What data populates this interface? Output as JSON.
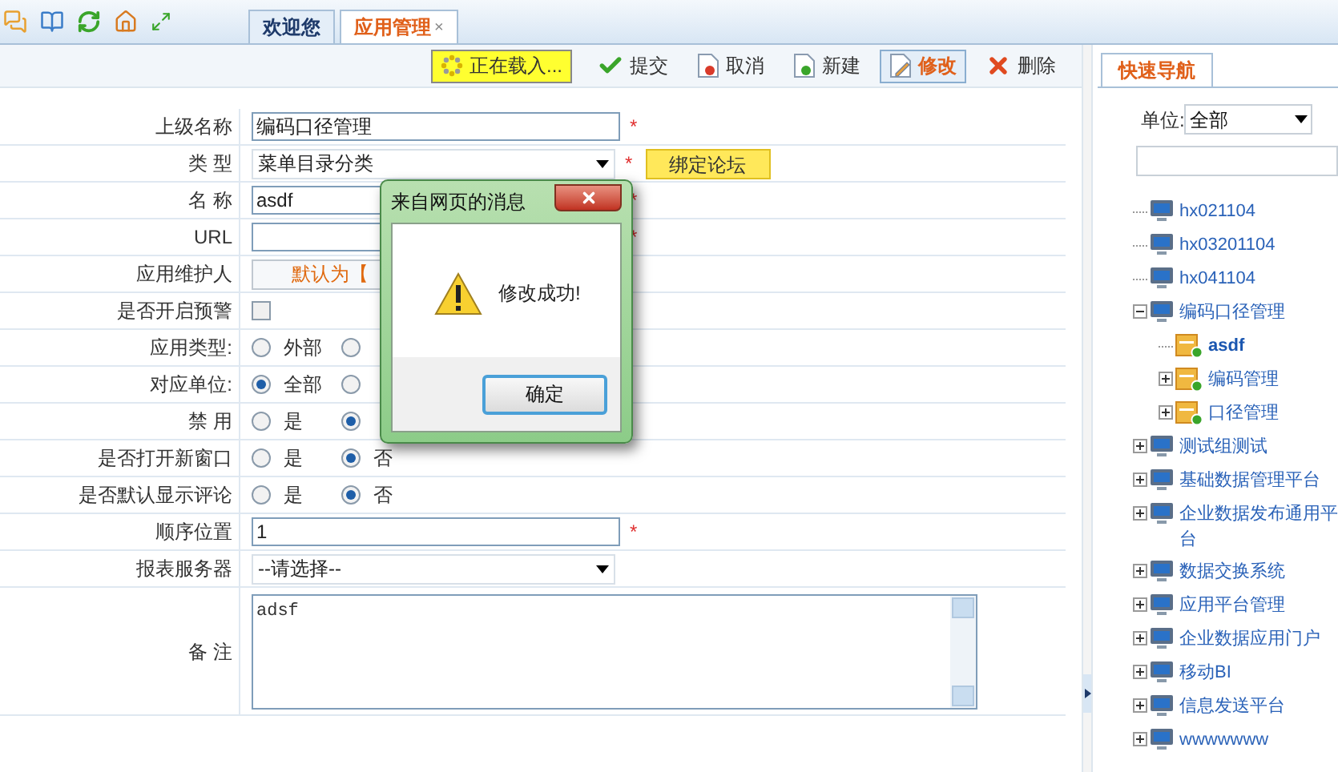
{
  "tabs": [
    {
      "label": "欢迎您",
      "selected": false
    },
    {
      "label": "应用管理",
      "selected": true,
      "close": "×"
    }
  ],
  "toolbar": [
    {
      "kind": "loading",
      "label": "正在载入..."
    },
    {
      "kind": "submit",
      "label": "提交",
      "selected": false
    },
    {
      "kind": "cancel",
      "label": "取消",
      "selected": false
    },
    {
      "kind": "new",
      "label": "新建",
      "selected": false
    },
    {
      "kind": "edit",
      "label": "修改",
      "selected": true
    },
    {
      "kind": "delete",
      "label": "删除",
      "selected": false
    }
  ],
  "form": {
    "rows": [
      {
        "kind": "text",
        "label": "上级名称",
        "value": "编码口径管理",
        "mark": "*"
      },
      {
        "kind": "select",
        "label": "类 型",
        "value": "菜单目录分类",
        "mark": "*",
        "button": "绑定论坛"
      },
      {
        "kind": "text",
        "label": "名 称",
        "value": "asdf",
        "mark": "*"
      },
      {
        "kind": "text",
        "label": "URL",
        "value": "",
        "mark": "*"
      },
      {
        "kind": "display",
        "label": "应用维护人",
        "value": "默认为【"
      },
      {
        "kind": "checkbox",
        "label": "是否开启预警",
        "checked": false
      },
      {
        "kind": "radio",
        "label": "应用类型:",
        "options": [
          {
            "label": "外部",
            "selected": false
          },
          {
            "selected": false
          }
        ]
      },
      {
        "kind": "radio",
        "label": "对应单位:",
        "options": [
          {
            "label": "全部",
            "selected": true
          },
          {
            "selected": false
          }
        ]
      },
      {
        "kind": "radio",
        "label": "禁 用",
        "options": [
          {
            "label": "是",
            "selected": false
          },
          {
            "selected": true
          }
        ]
      },
      {
        "kind": "radio",
        "label": "是否打开新窗口",
        "options": [
          {
            "label": "是",
            "selected": false
          },
          {
            "label": "否",
            "selected": true
          }
        ]
      },
      {
        "kind": "radio",
        "label": "是否默认显示评论",
        "options": [
          {
            "label": "是",
            "selected": false
          },
          {
            "label": "否",
            "selected": true
          }
        ]
      },
      {
        "kind": "text",
        "label": "顺序位置",
        "value": "1",
        "mark": "*"
      },
      {
        "kind": "select",
        "label": "报表服务器",
        "value": "--请选择--"
      },
      {
        "kind": "textarea",
        "label": "备 注",
        "value": "adsf"
      }
    ]
  },
  "dialog": {
    "title": "来自网页的消息",
    "message": "修改成功!",
    "ok": "确定"
  },
  "side_panel": {
    "tab": "快速导航",
    "unit_label": "单位:",
    "unit_value": "全部",
    "tree": [
      {
        "kind": "computer",
        "label": "hx021104",
        "selected": false
      },
      {
        "kind": "computer",
        "label": "hx03201104",
        "selected": false
      },
      {
        "kind": "computer",
        "label": "hx041104",
        "selected": false
      },
      {
        "kind": "computer",
        "label": "编码口径管理",
        "selected": false,
        "expanded": true,
        "children": [
          {
            "kind": "folder",
            "label": "asdf",
            "selected": true
          },
          {
            "kind": "folder",
            "label": "编码管理",
            "selected": false,
            "expanded": false
          },
          {
            "kind": "folder",
            "label": "口径管理",
            "selected": false,
            "expanded": false
          }
        ]
      },
      {
        "kind": "computer",
        "label": "测试组测试",
        "selected": false,
        "expanded": false
      },
      {
        "kind": "computer",
        "label": "基础数据管理平台",
        "selected": false,
        "expanded": false
      },
      {
        "kind": "computer",
        "label": "企业数据发布通用平台",
        "selected": false,
        "expanded": false
      },
      {
        "kind": "computer",
        "label": "数据交换系统",
        "selected": false,
        "expanded": false
      },
      {
        "kind": "computer",
        "label": "应用平台管理",
        "selected": false,
        "expanded": false
      },
      {
        "kind": "computer",
        "label": "企业数据应用门户",
        "selected": false,
        "expanded": false
      },
      {
        "kind": "computer",
        "label": "移动BI",
        "selected": false,
        "expanded": false
      },
      {
        "kind": "computer",
        "label": "信息发送平台",
        "selected": false,
        "expanded": false
      },
      {
        "kind": "computer",
        "label": "wwwwwww",
        "selected": false,
        "expanded": false
      }
    ]
  }
}
